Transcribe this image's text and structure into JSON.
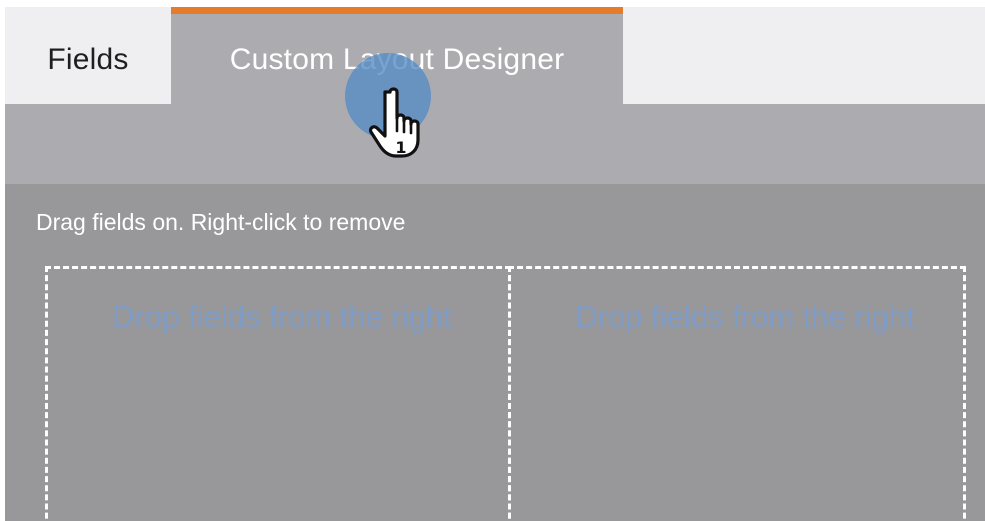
{
  "tabs": [
    {
      "label": "Fields",
      "active": false
    },
    {
      "label": "Custom Layout Designer",
      "active": true
    }
  ],
  "colors": {
    "active_tab_accent": "#e47c2b",
    "drop_hint_text": "#7f9cc7"
  },
  "designer": {
    "instruction": "Drag fields on. Right-click to remove",
    "drop_zones": [
      {
        "placeholder": "Drop fields from the right"
      },
      {
        "placeholder": "Drop fields from the right"
      }
    ]
  },
  "cursor": {
    "icon": "hand-pointer-icon",
    "click_count": "1"
  }
}
